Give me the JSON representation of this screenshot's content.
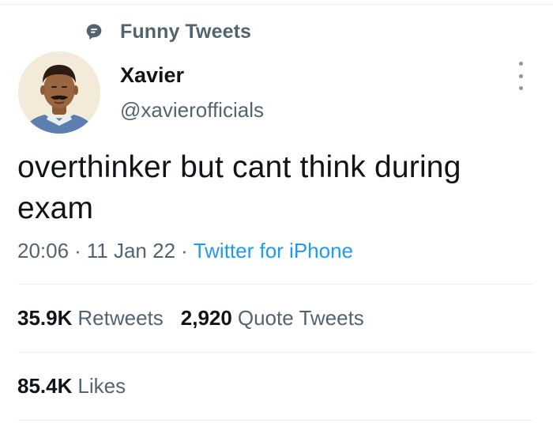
{
  "context": {
    "icon": "topic-icon",
    "label": "Funny Tweets"
  },
  "author": {
    "name": "Xavier",
    "handle": "@xavierofficials"
  },
  "tweet": {
    "text": "overthinker but cant think during exam",
    "time": "20:06",
    "date": "11 Jan 22",
    "separator": "·",
    "source": "Twitter for iPhone"
  },
  "stats": {
    "retweets": {
      "count": "35.9K",
      "label": "Retweets"
    },
    "quote_tweets": {
      "count": "2,920",
      "label": "Quote Tweets"
    },
    "likes": {
      "count": "85.4K",
      "label": "Likes"
    }
  },
  "colors": {
    "text_primary": "#0f1419",
    "text_secondary": "#536471",
    "link": "#1d9bf0",
    "divider": "#eff3f4"
  }
}
